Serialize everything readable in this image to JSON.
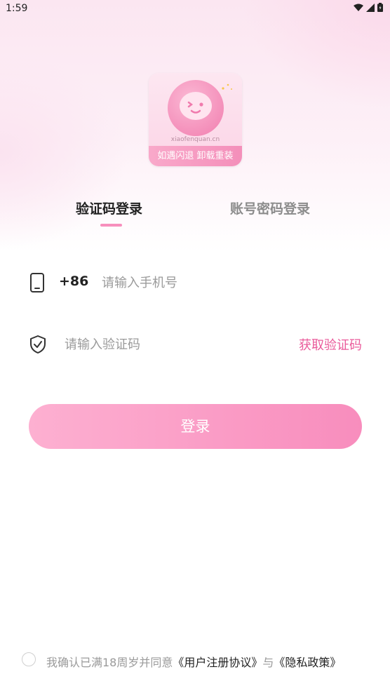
{
  "status_bar": {
    "time": "1:59"
  },
  "logo": {
    "site": "xiaofenquan.cn",
    "band_text": "如遇闪退  卸载重装"
  },
  "tabs": [
    {
      "label": "验证码登录",
      "active": true
    },
    {
      "label": "账号密码登录",
      "active": false
    }
  ],
  "phone": {
    "country_code": "+86",
    "placeholder": "请输入手机号"
  },
  "code": {
    "placeholder": "请输入验证码",
    "get_code_label": "获取验证码"
  },
  "login_button": {
    "label": "登录"
  },
  "agreement": {
    "prefix": "我确认已满18周岁并同意",
    "user_agreement": "《用户注册协议》",
    "connector": "与",
    "privacy_policy": "《隐私政策》"
  },
  "colors": {
    "accent": "#f88dbd",
    "link_pink": "#ea5b9b"
  }
}
